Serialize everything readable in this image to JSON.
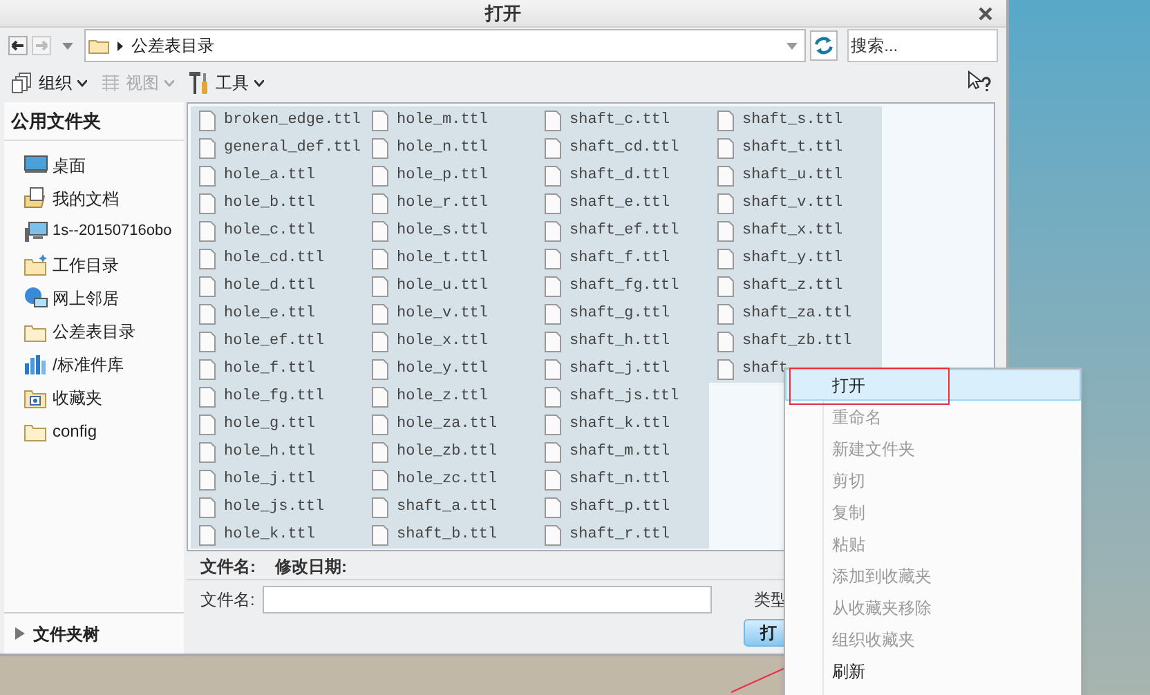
{
  "window": {
    "title": "打开"
  },
  "address": {
    "path": "公差表目录",
    "search_placeholder": "搜索..."
  },
  "toolbar": [
    {
      "label": "组织",
      "disabled": false
    },
    {
      "label": "视图",
      "disabled": true
    },
    {
      "label": "工具",
      "disabled": false
    }
  ],
  "sidebar": {
    "header": "公用文件夹",
    "items": [
      {
        "label": "桌面",
        "kind": "desktop"
      },
      {
        "label": "我的文档",
        "kind": "documents"
      },
      {
        "label": "1s--20150716obo",
        "kind": "computer"
      },
      {
        "label": "工作目录",
        "kind": "workdir"
      },
      {
        "label": "网上邻居",
        "kind": "network"
      },
      {
        "label": "公差表目录",
        "kind": "folder"
      },
      {
        "label": "/标准件库",
        "kind": "library"
      },
      {
        "label": "收藏夹",
        "kind": "favorites"
      },
      {
        "label": "config",
        "kind": "folder"
      }
    ],
    "tree_label": "文件夹树"
  },
  "files": [
    {
      "name": "broken_edge.ttl",
      "selected": true
    },
    {
      "name": "general_def.ttl",
      "selected": true
    },
    {
      "name": "hole_a.ttl",
      "selected": true
    },
    {
      "name": "hole_b.ttl",
      "selected": true
    },
    {
      "name": "hole_c.ttl",
      "selected": true
    },
    {
      "name": "hole_cd.ttl",
      "selected": true
    },
    {
      "name": "hole_d.ttl",
      "selected": true
    },
    {
      "name": "hole_e.ttl",
      "selected": true
    },
    {
      "name": "hole_ef.ttl",
      "selected": true
    },
    {
      "name": "hole_f.ttl",
      "selected": true
    },
    {
      "name": "hole_fg.ttl",
      "selected": true
    },
    {
      "name": "hole_g.ttl",
      "selected": true
    },
    {
      "name": "hole_h.ttl",
      "selected": true
    },
    {
      "name": "hole_j.ttl",
      "selected": true
    },
    {
      "name": "hole_js.ttl",
      "selected": true
    },
    {
      "name": "hole_k.ttl",
      "selected": true
    },
    {
      "name": "hole_m.ttl",
      "selected": true
    },
    {
      "name": "hole_n.ttl",
      "selected": true
    },
    {
      "name": "hole_p.ttl",
      "selected": true
    },
    {
      "name": "hole_r.ttl",
      "selected": true
    },
    {
      "name": "hole_s.ttl",
      "selected": true
    },
    {
      "name": "hole_t.ttl",
      "selected": true
    },
    {
      "name": "hole_u.ttl",
      "selected": true
    },
    {
      "name": "hole_v.ttl",
      "selected": true
    },
    {
      "name": "hole_x.ttl",
      "selected": true
    },
    {
      "name": "hole_y.ttl",
      "selected": true
    },
    {
      "name": "hole_z.ttl",
      "selected": true
    },
    {
      "name": "hole_za.ttl",
      "selected": true
    },
    {
      "name": "hole_zb.ttl",
      "selected": true
    },
    {
      "name": "hole_zc.ttl",
      "selected": true
    },
    {
      "name": "shaft_a.ttl",
      "selected": true
    },
    {
      "name": "shaft_b.ttl",
      "selected": true
    },
    {
      "name": "shaft_c.ttl",
      "selected": true
    },
    {
      "name": "shaft_cd.ttl",
      "selected": true
    },
    {
      "name": "shaft_d.ttl",
      "selected": true
    },
    {
      "name": "shaft_e.ttl",
      "selected": true
    },
    {
      "name": "shaft_ef.ttl",
      "selected": true
    },
    {
      "name": "shaft_f.ttl",
      "selected": true
    },
    {
      "name": "shaft_fg.ttl",
      "selected": true
    },
    {
      "name": "shaft_g.ttl",
      "selected": true
    },
    {
      "name": "shaft_h.ttl",
      "selected": true
    },
    {
      "name": "shaft_j.ttl",
      "selected": true
    },
    {
      "name": "shaft_js.ttl",
      "selected": true
    },
    {
      "name": "shaft_k.ttl",
      "selected": true
    },
    {
      "name": "shaft_m.ttl",
      "selected": true
    },
    {
      "name": "shaft_n.ttl",
      "selected": true
    },
    {
      "name": "shaft_p.ttl",
      "selected": true
    },
    {
      "name": "shaft_r.ttl",
      "selected": true
    },
    {
      "name": "shaft_s.ttl",
      "selected": true
    },
    {
      "name": "shaft_t.ttl",
      "selected": true
    },
    {
      "name": "shaft_u.ttl",
      "selected": true
    },
    {
      "name": "shaft_v.ttl",
      "selected": true
    },
    {
      "name": "shaft_x.ttl",
      "selected": true
    },
    {
      "name": "shaft_y.ttl",
      "selected": true
    },
    {
      "name": "shaft_z.ttl",
      "selected": true
    },
    {
      "name": "shaft_za.ttl",
      "selected": true
    },
    {
      "name": "shaft_zb.ttl",
      "selected": true
    },
    {
      "name": "shaft",
      "selected": true
    }
  ],
  "details": {
    "name_label": "文件名:",
    "date_label": "修改日期:"
  },
  "footer": {
    "filename_label": "文件名:",
    "type_label": "类型",
    "open_button": "打"
  },
  "context_menu": [
    {
      "label": "打开",
      "disabled": false,
      "selected": true,
      "annotated": true
    },
    {
      "label": "重命名",
      "disabled": true,
      "selected": false,
      "annotated": false
    },
    {
      "label": "新建文件夹",
      "disabled": true,
      "selected": false,
      "annotated": false
    },
    {
      "label": "剪切",
      "disabled": true,
      "selected": false,
      "annotated": false
    },
    {
      "label": "复制",
      "disabled": true,
      "selected": false,
      "annotated": false
    },
    {
      "label": "粘贴",
      "disabled": true,
      "selected": false,
      "annotated": false
    },
    {
      "label": "添加到收藏夹",
      "disabled": true,
      "selected": false,
      "annotated": false
    },
    {
      "label": "从收藏夹移除",
      "disabled": true,
      "selected": false,
      "annotated": false
    },
    {
      "label": "组织收藏夹",
      "disabled": true,
      "selected": false,
      "annotated": false
    },
    {
      "label": "刷新",
      "disabled": false,
      "selected": false,
      "annotated": false
    }
  ]
}
